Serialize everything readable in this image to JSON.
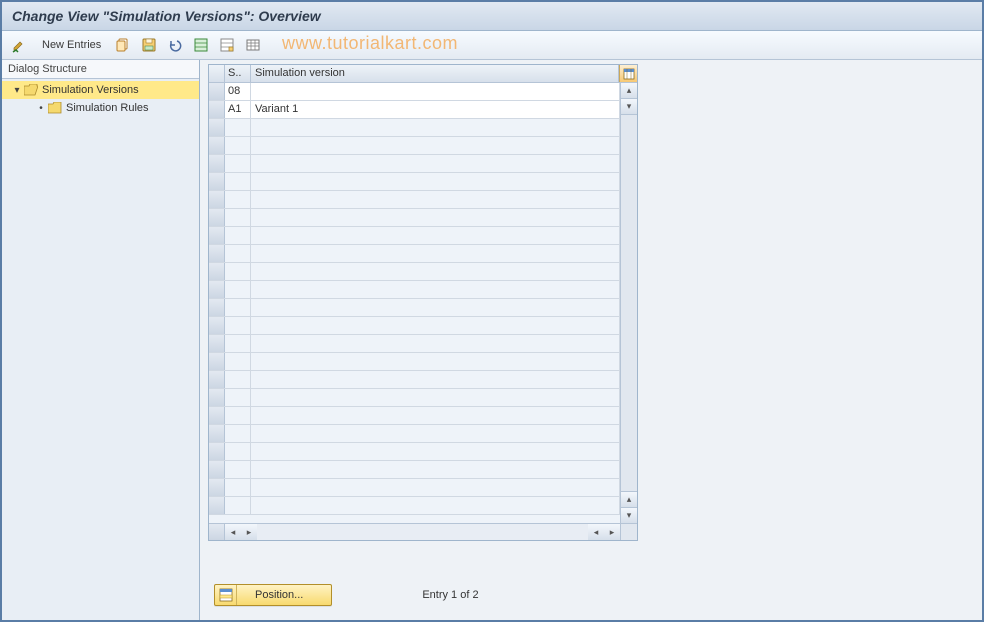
{
  "title": "Change View \"Simulation Versions\": Overview",
  "toolbar": {
    "new_entries_label": "New Entries"
  },
  "watermark": "www.tutorialkart.com",
  "tree": {
    "header": "Dialog Structure",
    "items": [
      {
        "label": "Simulation Versions",
        "level": 1,
        "expanded": true,
        "selected": true,
        "folder": "open"
      },
      {
        "label": "Simulation Rules",
        "level": 2,
        "expanded": false,
        "selected": false,
        "folder": "closed"
      }
    ]
  },
  "grid": {
    "columns": {
      "c1": "S..",
      "c2": "Simulation version"
    },
    "rows": [
      {
        "c1": "08",
        "c2": ""
      },
      {
        "c1": "A1",
        "c2": "Variant 1"
      }
    ]
  },
  "footer": {
    "position_label": "Position...",
    "entry_status": "Entry 1 of 2"
  }
}
